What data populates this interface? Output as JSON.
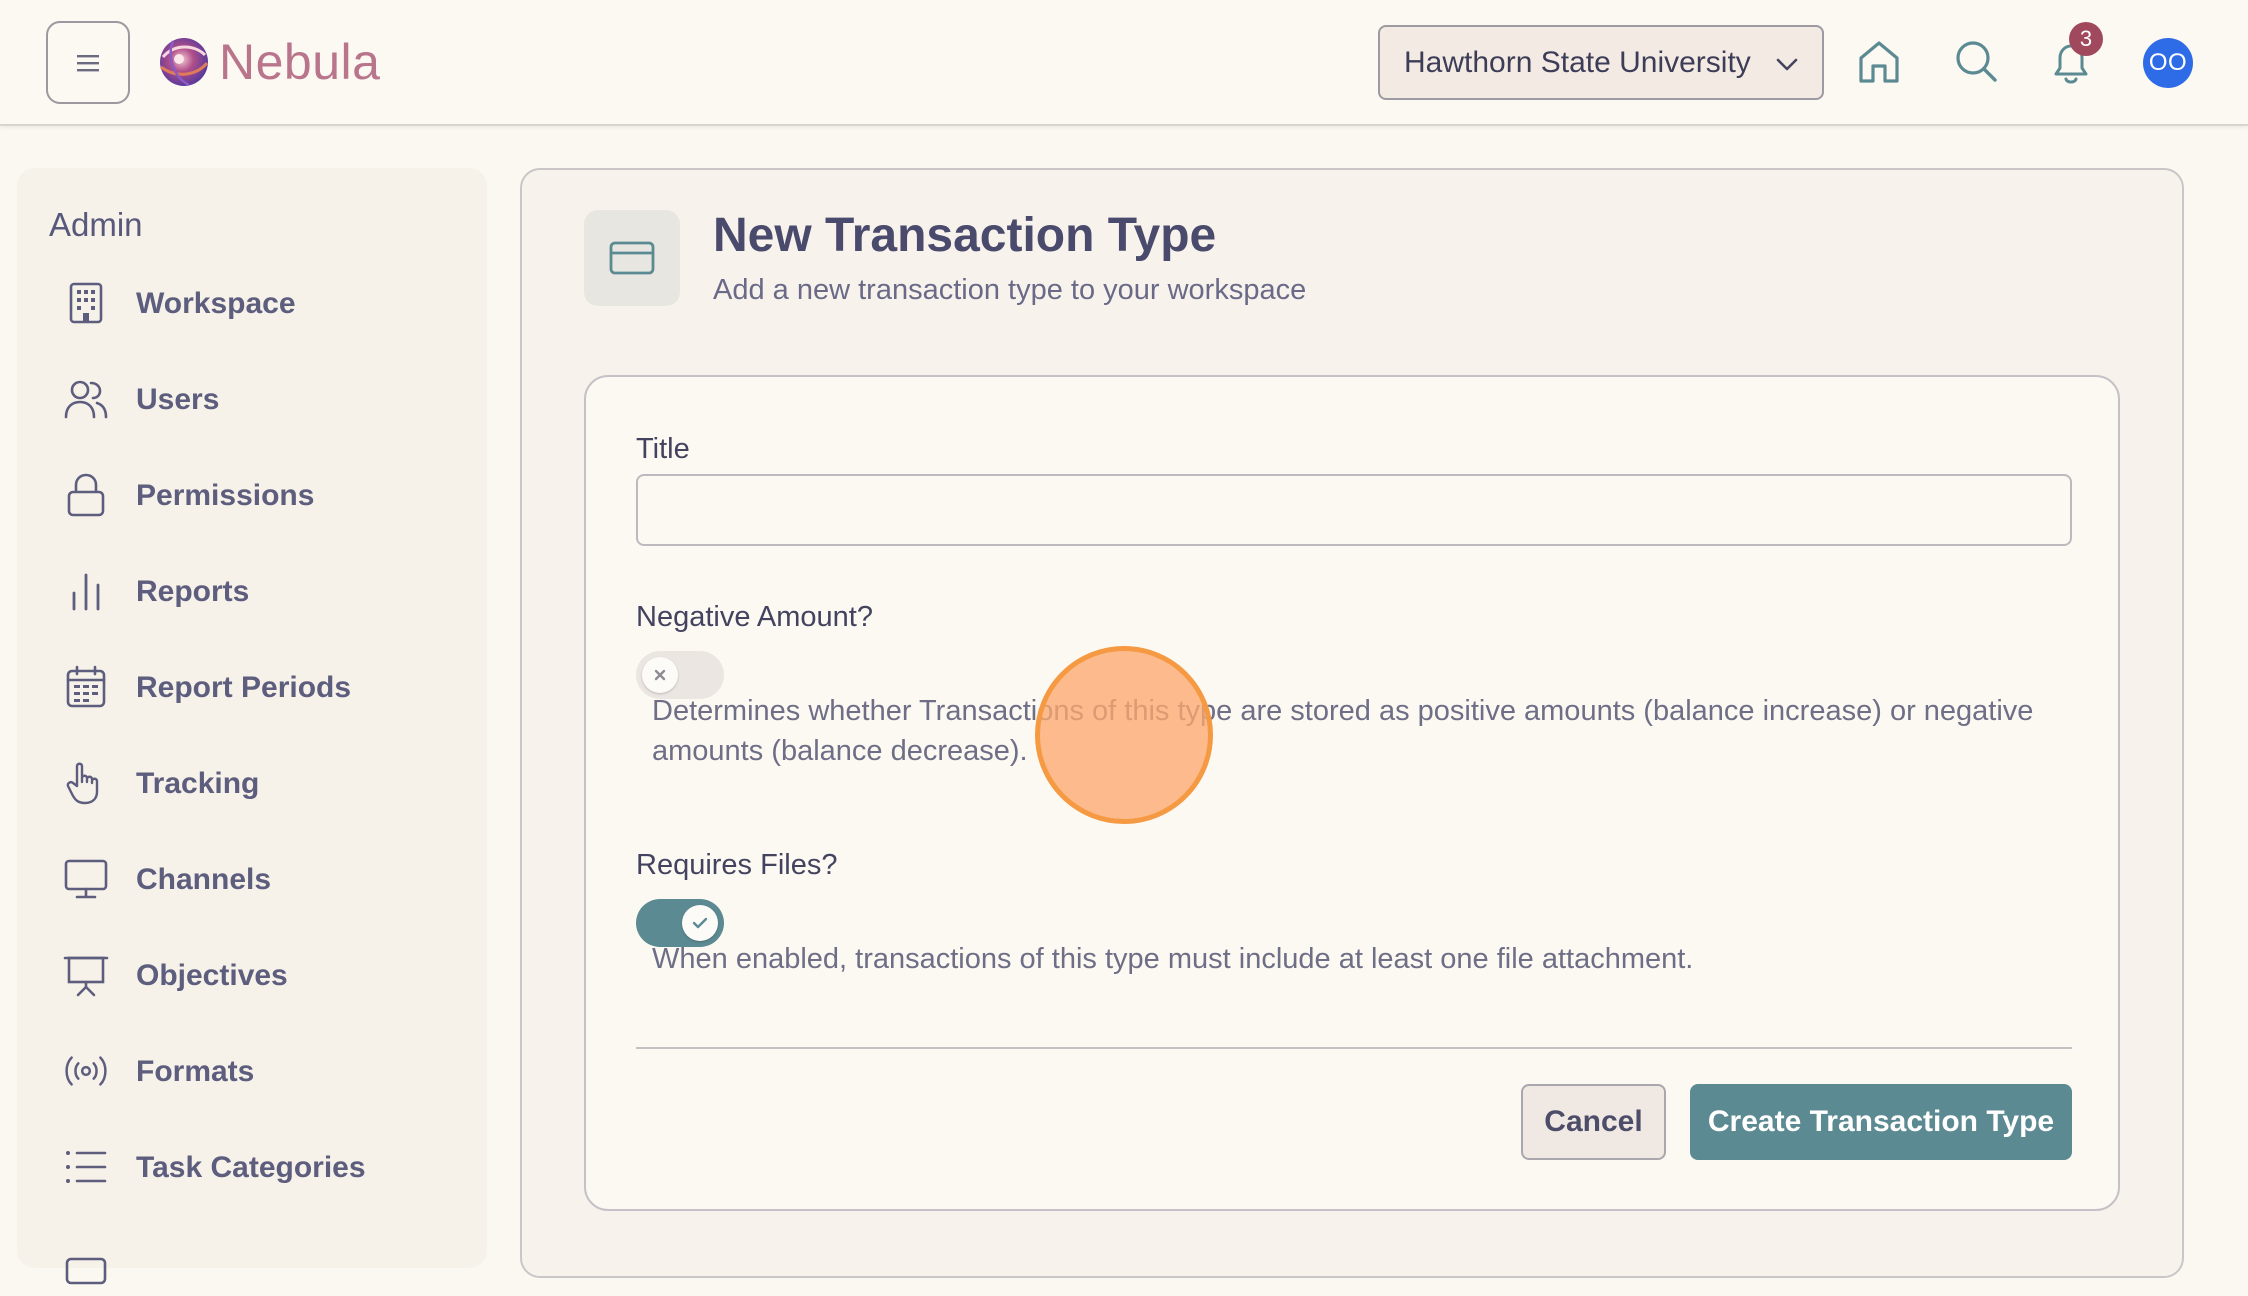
{
  "app": {
    "name": "Nebula"
  },
  "header": {
    "organization": "Hawthorn State University",
    "notifications_count": "3",
    "avatar_initials": "OO"
  },
  "sidebar": {
    "heading": "Admin",
    "items": [
      {
        "label": "Workspace",
        "icon": "building-icon"
      },
      {
        "label": "Users",
        "icon": "users-icon"
      },
      {
        "label": "Permissions",
        "icon": "lock-icon"
      },
      {
        "label": "Reports",
        "icon": "bar-chart-icon"
      },
      {
        "label": "Report Periods",
        "icon": "calendar-icon"
      },
      {
        "label": "Tracking",
        "icon": "pointer-hand-icon"
      },
      {
        "label": "Channels",
        "icon": "monitor-icon"
      },
      {
        "label": "Objectives",
        "icon": "presentation-icon"
      },
      {
        "label": "Formats",
        "icon": "broadcast-icon"
      },
      {
        "label": "Task Categories",
        "icon": "list-icon"
      }
    ]
  },
  "page": {
    "title": "New Transaction Type",
    "subtitle": "Add a new transaction type to your workspace",
    "icon": "credit-card-icon"
  },
  "form": {
    "title_label": "Title",
    "title_value": "",
    "title_placeholder": "",
    "negative_label": "Negative Amount?",
    "negative_enabled": false,
    "negative_help": "Determines whether Transactions of this type are stored as positive amounts (balance increase) or negative amounts (balance decrease).",
    "files_label": "Requires Files?",
    "files_enabled": true,
    "files_help": "When enabled, transactions of this type must include at least one file attachment.",
    "cancel_label": "Cancel",
    "submit_label": "Create Transaction Type"
  },
  "colors": {
    "accent": "#5c8a92",
    "background": "#fbf8f1",
    "badge": "#a0495d",
    "avatar": "#2e6be6",
    "cursor_highlight": "#f59a43"
  }
}
